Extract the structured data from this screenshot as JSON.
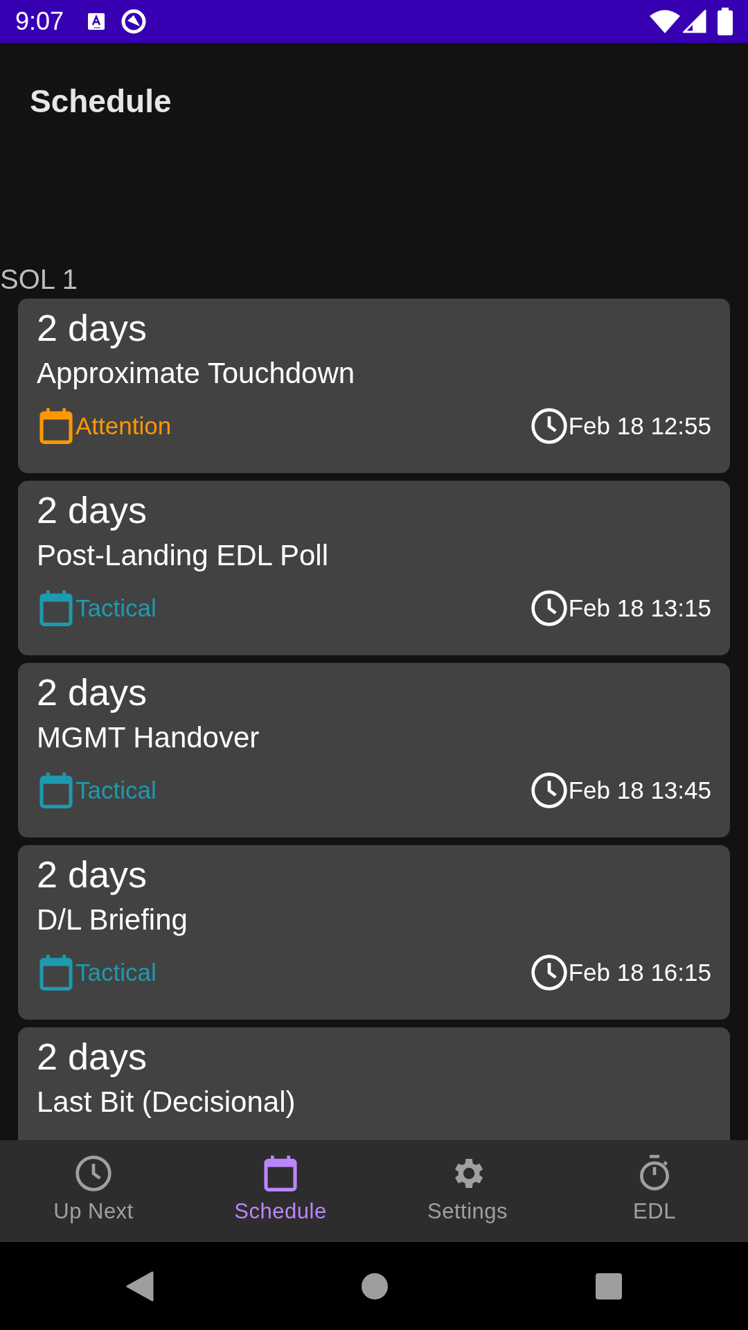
{
  "status_bar": {
    "time": "9:07"
  },
  "header": {
    "title": "Schedule"
  },
  "sections": [
    {
      "label": "SOL 1",
      "events": [
        {
          "countdown": "2 days",
          "title": "Approximate Touchdown",
          "category": "Attention",
          "color": "#ff9800",
          "time": "Feb 18 12:55"
        },
        {
          "countdown": "2 days",
          "title": "Post-Landing EDL Poll",
          "category": "Tactical",
          "color": "#1e9aae",
          "time": "Feb 18 13:15"
        },
        {
          "countdown": "2 days",
          "title": "MGMT Handover",
          "category": "Tactical",
          "color": "#1e9aae",
          "time": "Feb 18 13:45"
        },
        {
          "countdown": "2 days",
          "title": "D/L Briefing",
          "category": "Tactical",
          "color": "#1e9aae",
          "time": "Feb 18 16:15"
        },
        {
          "countdown": "2 days",
          "title": "Last Bit (Decisional)"
        }
      ]
    }
  ],
  "bottom_nav": [
    {
      "kind": "clock",
      "label": "Up Next",
      "selected": false
    },
    {
      "kind": "calendar",
      "label": "Schedule",
      "selected": true
    },
    {
      "kind": "gear",
      "label": "Settings",
      "selected": false
    },
    {
      "kind": "stopwatch",
      "label": "EDL",
      "selected": false
    }
  ]
}
